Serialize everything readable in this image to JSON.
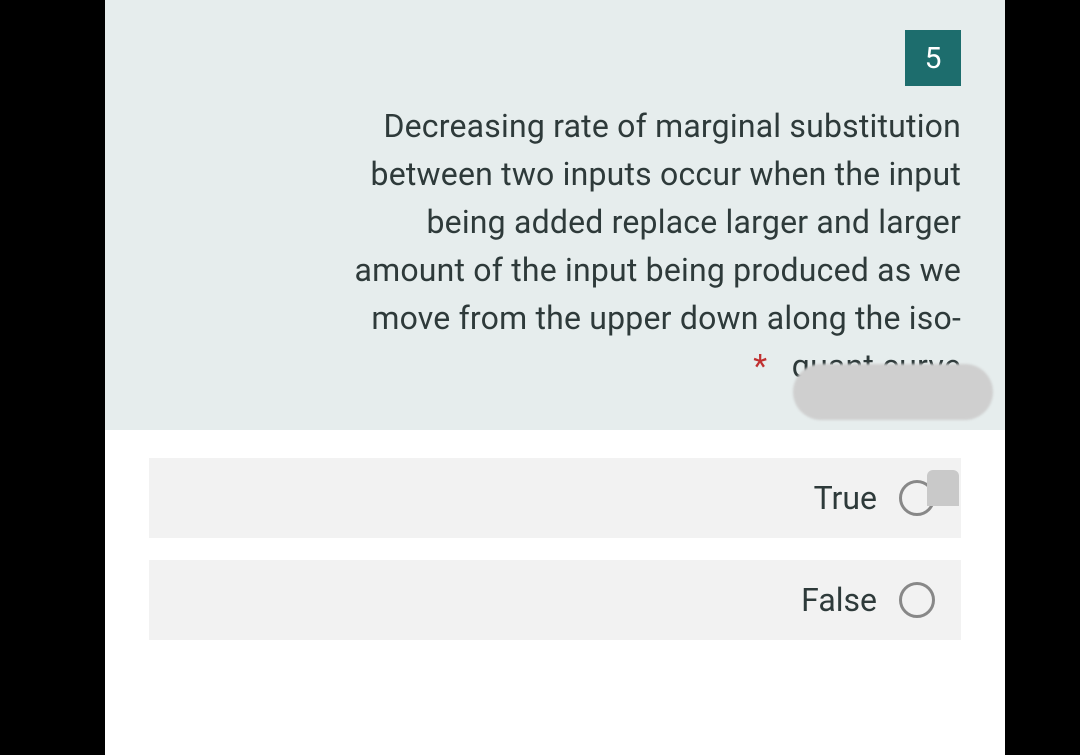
{
  "question": {
    "number": "5",
    "text": "Decreasing rate of marginal substitution between two inputs occur when the input being added replace larger and larger amount of the input being produced as we move from the upper down along the iso-quant curve",
    "required_marker": "*"
  },
  "options": [
    {
      "label": "True"
    },
    {
      "label": "False"
    }
  ]
}
